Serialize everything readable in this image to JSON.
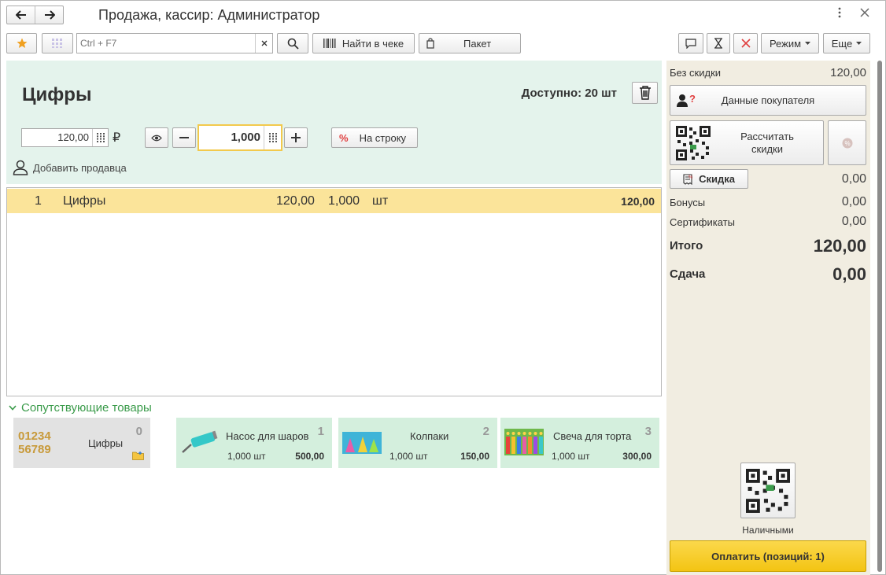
{
  "window": {
    "title": "Продажа, кассир: Администратор"
  },
  "toolbar": {
    "search_placeholder": "Ctrl + F7",
    "find_in_receipt_label": "Найти в чеке",
    "package_label": "Пакет",
    "mode_label": "Режим",
    "more_label": "Еще"
  },
  "product": {
    "name": "Цифры",
    "available": "Доступно: 20 шт",
    "price": "120,00",
    "currency": "₽",
    "quantity": "1,000",
    "to_line_label": "На строку",
    "add_seller_label": "Добавить продавца"
  },
  "lines": [
    {
      "num": "1",
      "name": "Цифры",
      "price": "120,00",
      "qty": "1,000",
      "unit": "шт",
      "sum": "120,00"
    }
  ],
  "related": {
    "title": "Сопутствующие товары",
    "items": [
      {
        "index": "0",
        "name": "Цифры",
        "qty": "",
        "price": "",
        "image_text": "01234 56789"
      },
      {
        "index": "1",
        "name": "Насос для шаров",
        "qty": "1,000 шт",
        "price": "500,00"
      },
      {
        "index": "2",
        "name": "Колпаки",
        "qty": "1,000 шт",
        "price": "150,00"
      },
      {
        "index": "3",
        "name": "Свеча для торта",
        "qty": "1,000 шт",
        "price": "300,00"
      }
    ]
  },
  "summary": {
    "no_discount_label": "Без скидки",
    "no_discount_value": "120,00",
    "customer_data_label": "Данные покупателя",
    "calc_discounts_label": "Рассчитать скидки",
    "discount_label": "Скидка",
    "discount_value": "0,00",
    "bonuses_label": "Бонусы",
    "bonuses_value": "0,00",
    "certificates_label": "Сертификаты",
    "certificates_value": "0,00",
    "total_label": "Итого",
    "total_value": "120,00",
    "change_label": "Сдача",
    "change_value": "0,00",
    "cash_label": "Наличными",
    "pay_label": "Оплатить (позиций: 1)"
  },
  "colors": {
    "accent_yellow": "#f3c413",
    "panel_green": "#e4f3ec",
    "row_yellow": "#fbe49a",
    "related_green": "#3a9b4a"
  }
}
